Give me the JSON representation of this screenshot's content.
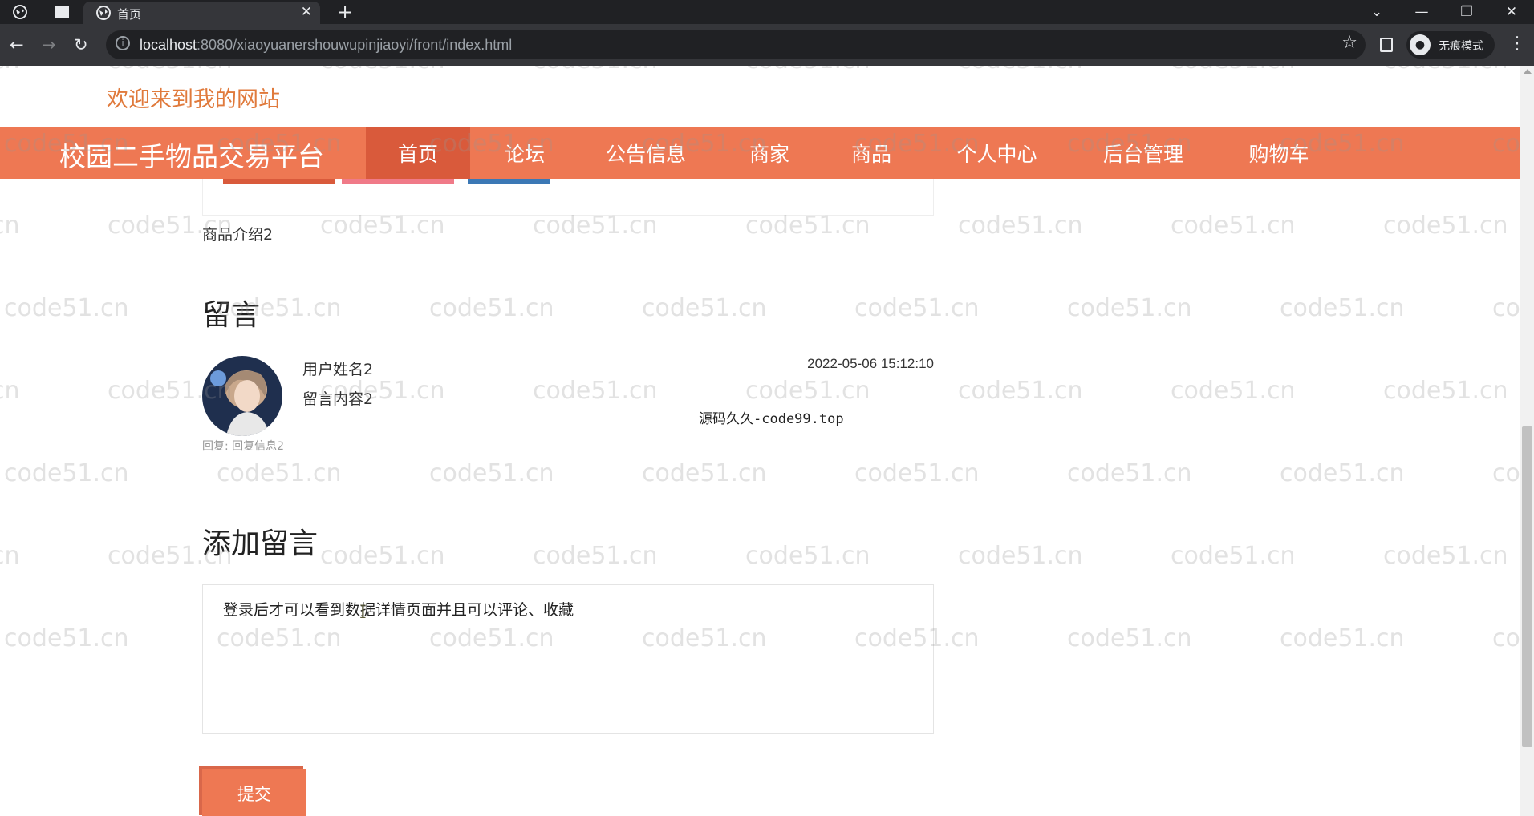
{
  "browser": {
    "tab_title": "首页",
    "url_host": "localhost",
    "url_rest": ":8080/xiaoyuanershouwupinjiaoyi/front/index.html",
    "incognito_label": "无痕模式"
  },
  "site": {
    "welcome": "欢迎来到我的网站",
    "brand": "校园二手物品交易平台",
    "nav": [
      {
        "label": "首页",
        "active": true
      },
      {
        "label": "论坛"
      },
      {
        "label": "公告信息"
      },
      {
        "label": "商家"
      },
      {
        "label": "商品"
      },
      {
        "label": "个人中心"
      },
      {
        "label": "后台管理"
      },
      {
        "label": "购物车"
      }
    ]
  },
  "product": {
    "intro": "商品介绍2"
  },
  "comments": {
    "heading": "留言",
    "items": [
      {
        "username": "用户姓名2",
        "content": "留言内容2",
        "time": "2022-05-06 15:12:10",
        "reply_label": "回复:",
        "reply": "回复信息2"
      }
    ]
  },
  "source_note": "源码久久-code99.top",
  "add_comment": {
    "heading": "添加留言",
    "text": "登录后才可以看到数据详情页面并且可以评论、收藏",
    "submit_label": "提交"
  },
  "watermark": "code51.cn",
  "colors": {
    "accent": "#ee7853",
    "accent_dark": "#d95a3b",
    "welcome": "#e07a3c"
  }
}
